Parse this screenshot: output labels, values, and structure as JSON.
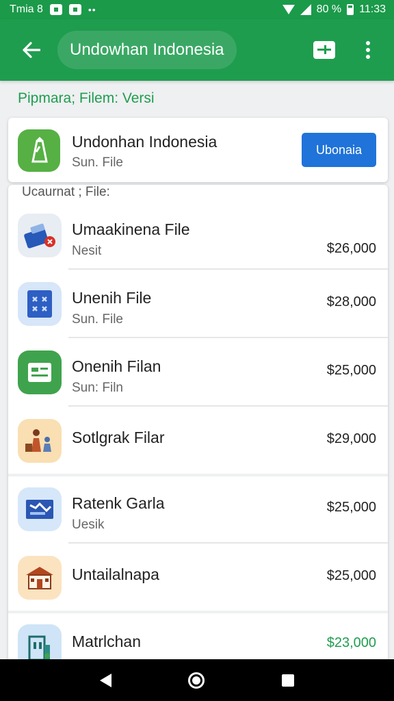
{
  "status_bar": {
    "carrier": "Tmia 8",
    "dots": "••",
    "battery_percent": "80 %",
    "time": "11:33"
  },
  "app_bar": {
    "title": "Undowhan Indonesia"
  },
  "section": {
    "title": "Pipmara; Filem: Versi"
  },
  "featured": {
    "title": "Undonhan Indonesia",
    "subtitle": "Sun. File",
    "button_label": "Ubonaia"
  },
  "list": {
    "label": "Ucaurnat ; File:",
    "items": [
      {
        "title": "Umaakinena File",
        "subtitle": "Nesit",
        "price": "$26,000",
        "icon": "toolbox-icon",
        "bg": "#e8edf3"
      },
      {
        "title": "Unenih File",
        "subtitle": "Sun. File",
        "price": "$28,000",
        "icon": "pattern-icon",
        "bg": "#d7e6f8"
      },
      {
        "title": "Onenih Filan",
        "subtitle": "Sun: Filn",
        "price": "$25,000",
        "icon": "document-icon",
        "bg": "#3fa34d"
      },
      {
        "title": "Sotlgrak Filar",
        "subtitle": "",
        "price": "$29,000",
        "icon": "people-icon",
        "bg": "#f9dfb2"
      },
      {
        "title": "Ratenk Garla",
        "subtitle": "Uesik",
        "price": "$25,000",
        "icon": "map-icon",
        "bg": "#d6e7fa"
      },
      {
        "title": "Untailalnapa",
        "subtitle": "",
        "price": "$25,000",
        "icon": "house-icon",
        "bg": "#fbe3c0"
      },
      {
        "title": "Matrlchan",
        "subtitle": "",
        "price": "$23,000",
        "icon": "building-icon",
        "bg": "#cfe4f7"
      }
    ]
  },
  "colors": {
    "primary": "#1f9d4f",
    "button": "#1f73d9"
  }
}
